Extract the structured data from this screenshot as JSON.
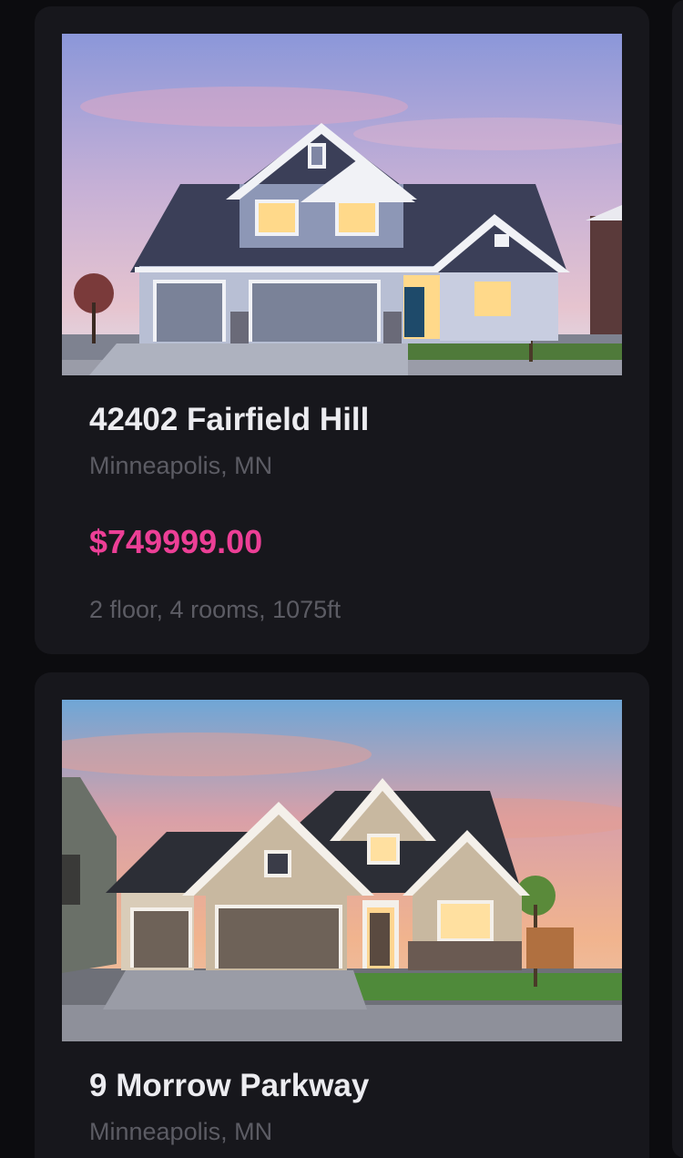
{
  "listings": [
    {
      "title": "42402 Fairfield Hill",
      "location": "Minneapolis, MN",
      "price": "$749999.00",
      "specs": "2 floor, 4 rooms, 1075ft"
    },
    {
      "title": "9 Morrow Parkway",
      "location": "Minneapolis, MN"
    }
  ],
  "colors": {
    "background": "#0c0c0f",
    "card": "#17171c",
    "title": "#ececf0",
    "muted": "#5c5c64",
    "price": "#ec3f96"
  }
}
